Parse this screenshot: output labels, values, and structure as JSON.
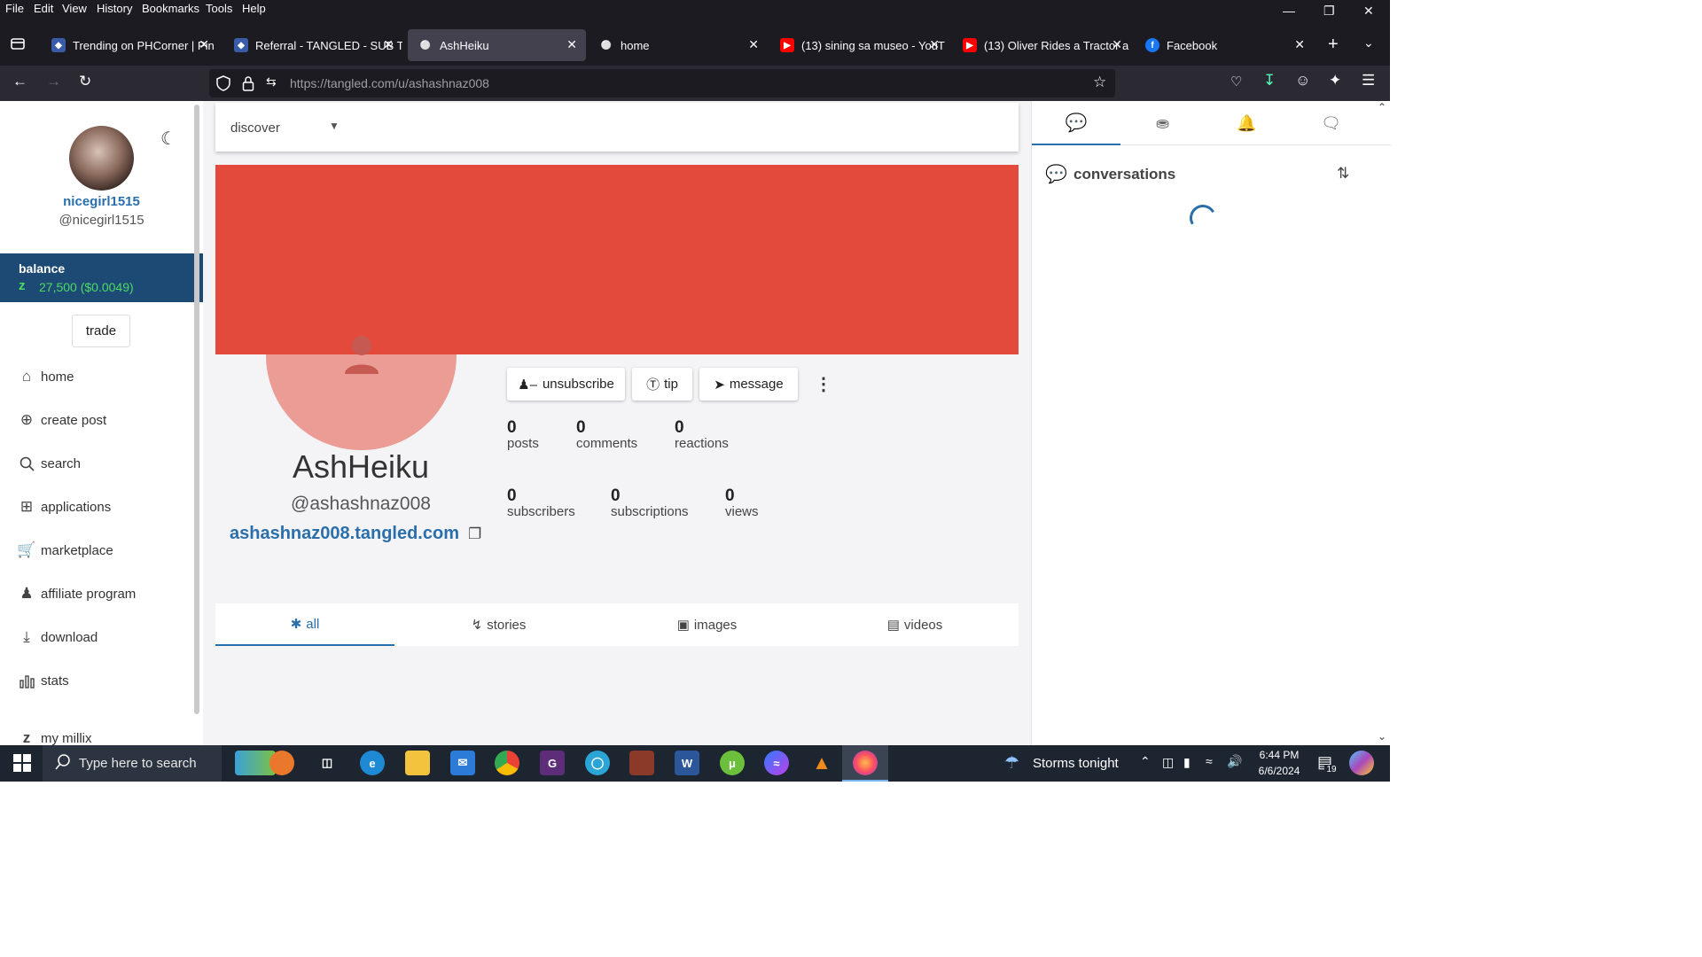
{
  "menubar": {
    "items": [
      "File",
      "Edit",
      "View",
      "History",
      "Bookmarks",
      "Tools",
      "Help"
    ]
  },
  "tabs": [
    {
      "title": "Trending on PHCorner | Pin"
    },
    {
      "title": "Referral - TANGLED - SUB T"
    },
    {
      "title": "AshHeiku"
    },
    {
      "title": "home"
    },
    {
      "title": "(13) sining sa museo - YouT"
    },
    {
      "title": "(13) Oliver Rides a Tractor a"
    },
    {
      "title": "Facebook"
    }
  ],
  "address_bar": {
    "url": "https://tangled.com/u/ashashnaz008"
  },
  "sidebar": {
    "display_name": "nicegirl1515",
    "handle": "@nicegirl1515",
    "balance_label": "balance",
    "balance_value": "27,500 ($0.0049)",
    "trade_label": "trade",
    "items": [
      {
        "label": "home",
        "icon": "home-icon"
      },
      {
        "label": "create post",
        "icon": "plus-circle-icon"
      },
      {
        "label": "search",
        "icon": "search-icon"
      },
      {
        "label": "applications",
        "icon": "apps-grid-icon"
      },
      {
        "label": "marketplace",
        "icon": "cart-icon"
      },
      {
        "label": "affiliate program",
        "icon": "people-icon"
      },
      {
        "label": "download",
        "icon": "download-icon"
      },
      {
        "label": "stats",
        "icon": "bar-chart-icon"
      },
      {
        "label": "my millix",
        "icon": "millix-icon"
      }
    ]
  },
  "main": {
    "discover_label": "discover",
    "banner_color": "#e34a3b",
    "profile": {
      "name": "AshHeiku",
      "handle": "@ashashnaz008",
      "link": "ashashnaz008.tangled.com"
    },
    "actions": {
      "unsubscribe": "unsubscribe",
      "tip": "tip",
      "message": "message"
    },
    "stats": {
      "posts": {
        "value": "0",
        "label": "posts"
      },
      "comments": {
        "value": "0",
        "label": "comments"
      },
      "reactions": {
        "value": "0",
        "label": "reactions"
      },
      "subscribers": {
        "value": "0",
        "label": "subscribers"
      },
      "subscriptions": {
        "value": "0",
        "label": "subscriptions"
      },
      "views": {
        "value": "0",
        "label": "views"
      }
    },
    "content_tabs": [
      {
        "label": "all",
        "icon": "asterisk-icon"
      },
      {
        "label": "stories",
        "icon": "bolt-icon"
      },
      {
        "label": "images",
        "icon": "image-icon"
      },
      {
        "label": "videos",
        "icon": "video-icon"
      }
    ]
  },
  "right_panel": {
    "title": "conversations"
  },
  "taskbar": {
    "search_placeholder": "Type here to search",
    "weather": "Storms tonight",
    "time": "6:44 PM",
    "date": "6/6/2024",
    "notification_count": "19"
  },
  "colors": {
    "accent_blue": "#2a6fab",
    "balance_bg": "#1d4a74",
    "balance_green": "#4cd964"
  }
}
